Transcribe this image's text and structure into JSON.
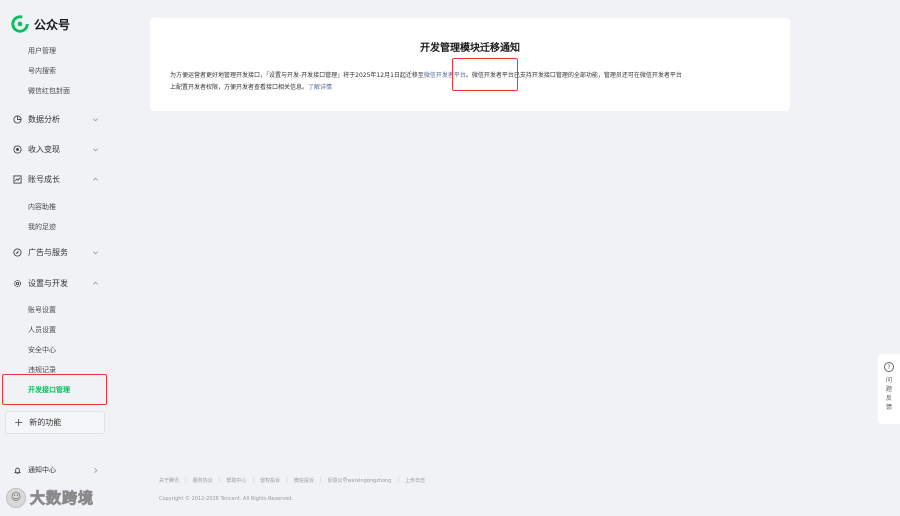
{
  "app": {
    "logo_text": "公众号"
  },
  "sidebar": {
    "top_items": [
      {
        "label": "用户管理"
      },
      {
        "label": "号内搜索"
      },
      {
        "label": "微信红包封面"
      }
    ],
    "categories": [
      {
        "label": "数据分析",
        "icon": "chart-pie-icon",
        "expanded": false
      },
      {
        "label": "收入变现",
        "icon": "coin-icon",
        "expanded": false
      },
      {
        "label": "账号成长",
        "icon": "trend-icon",
        "expanded": true
      },
      {
        "label": "广告与服务",
        "icon": "compass-icon",
        "expanded": false
      },
      {
        "label": "设置与开发",
        "icon": "gear-icon",
        "expanded": true
      }
    ],
    "growth_items": [
      {
        "label": "内容助推"
      },
      {
        "label": "我的足迹"
      }
    ],
    "settings_items": [
      {
        "label": "账号设置"
      },
      {
        "label": "人员设置"
      },
      {
        "label": "安全中心"
      },
      {
        "label": "违规记录"
      },
      {
        "label": "开发接口管理",
        "active": true
      }
    ],
    "new_function": "新的功能",
    "notifications": "通知中心"
  },
  "notice": {
    "title": "开发管理模块迁移通知",
    "line1_prefix": "为方便运营者更好地管理开发接口，「设置与开发-开发接口管理」将于2025年12月1日起迁移至",
    "line1_link": "微信开发者平台",
    "line1_suffix": "。微信开发者平台已支持开发接口管理的全部功能，管理员还可在微信开发者平台",
    "line2_prefix": "上配置开发者权限，方便开发者查看接口相关信息。",
    "line2_link": "了解详情"
  },
  "footer": {
    "links": [
      "关于腾讯",
      "服务协议",
      "帮助中心",
      "侵权投诉",
      "微信投诉",
      "反馈公号weixingongzhong",
      "上传日志"
    ],
    "copyright": "Copyright © 2012-2026 Tencent. All Rights Reserved."
  },
  "feedback": {
    "icon_text": "?",
    "label": "问题反馈"
  },
  "watermark": {
    "text": "大数跨境"
  },
  "colors": {
    "accent": "#07c160",
    "link": "#576b95",
    "highlight": "#e53935"
  }
}
